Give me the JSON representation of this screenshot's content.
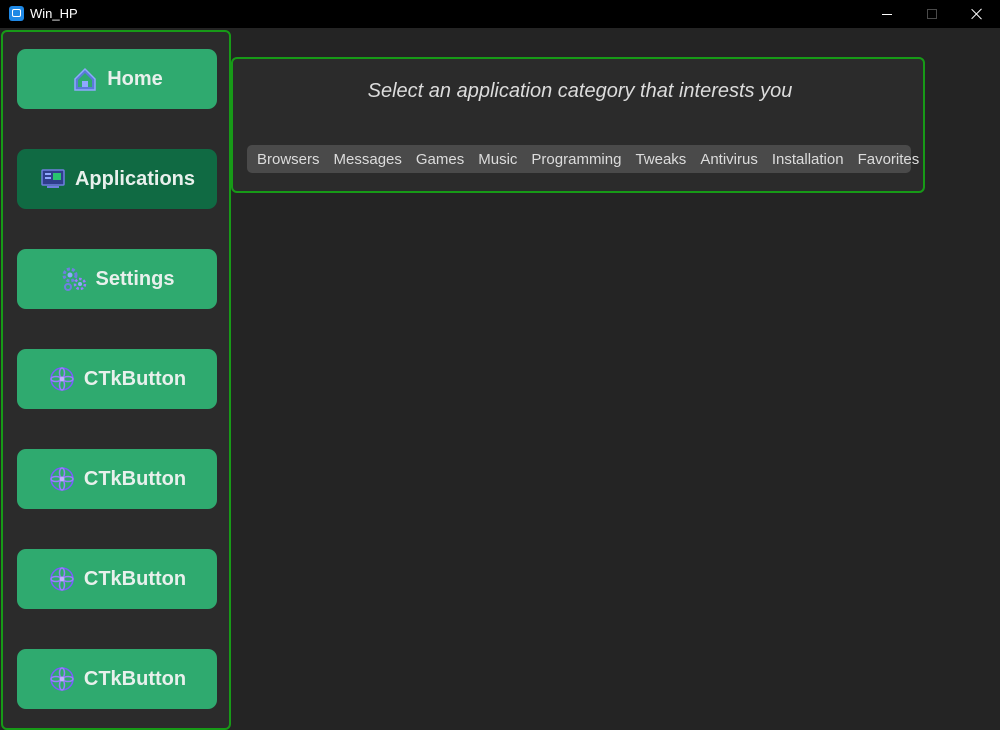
{
  "window": {
    "title": "Win_HP"
  },
  "sidebar": {
    "items": [
      {
        "label": "Home",
        "icon": "home-icon",
        "active": false
      },
      {
        "label": "Applications",
        "icon": "applications-icon",
        "active": true
      },
      {
        "label": "Settings",
        "icon": "settings-gears-icon",
        "active": false
      },
      {
        "label": "CTkButton",
        "icon": "flower-icon",
        "active": false
      },
      {
        "label": "CTkButton",
        "icon": "flower-icon",
        "active": false
      },
      {
        "label": "CTkButton",
        "icon": "flower-icon",
        "active": false
      },
      {
        "label": "CTkButton",
        "icon": "flower-icon",
        "active": false
      }
    ]
  },
  "main": {
    "prompt": "Select an application category that interests you",
    "categories": [
      "Browsers",
      "Messages",
      "Games",
      "Music",
      "Programming",
      "Tweaks",
      "Antivirus",
      "Installation",
      "Favorites"
    ]
  },
  "colors": {
    "background": "#242424",
    "frame": "#2b2b2b",
    "border": "#179a17",
    "button": "#2faa6f",
    "button_active": "#106a43",
    "segmented_bg": "#4a4a4a",
    "icon_purple": "#7a5cff"
  }
}
